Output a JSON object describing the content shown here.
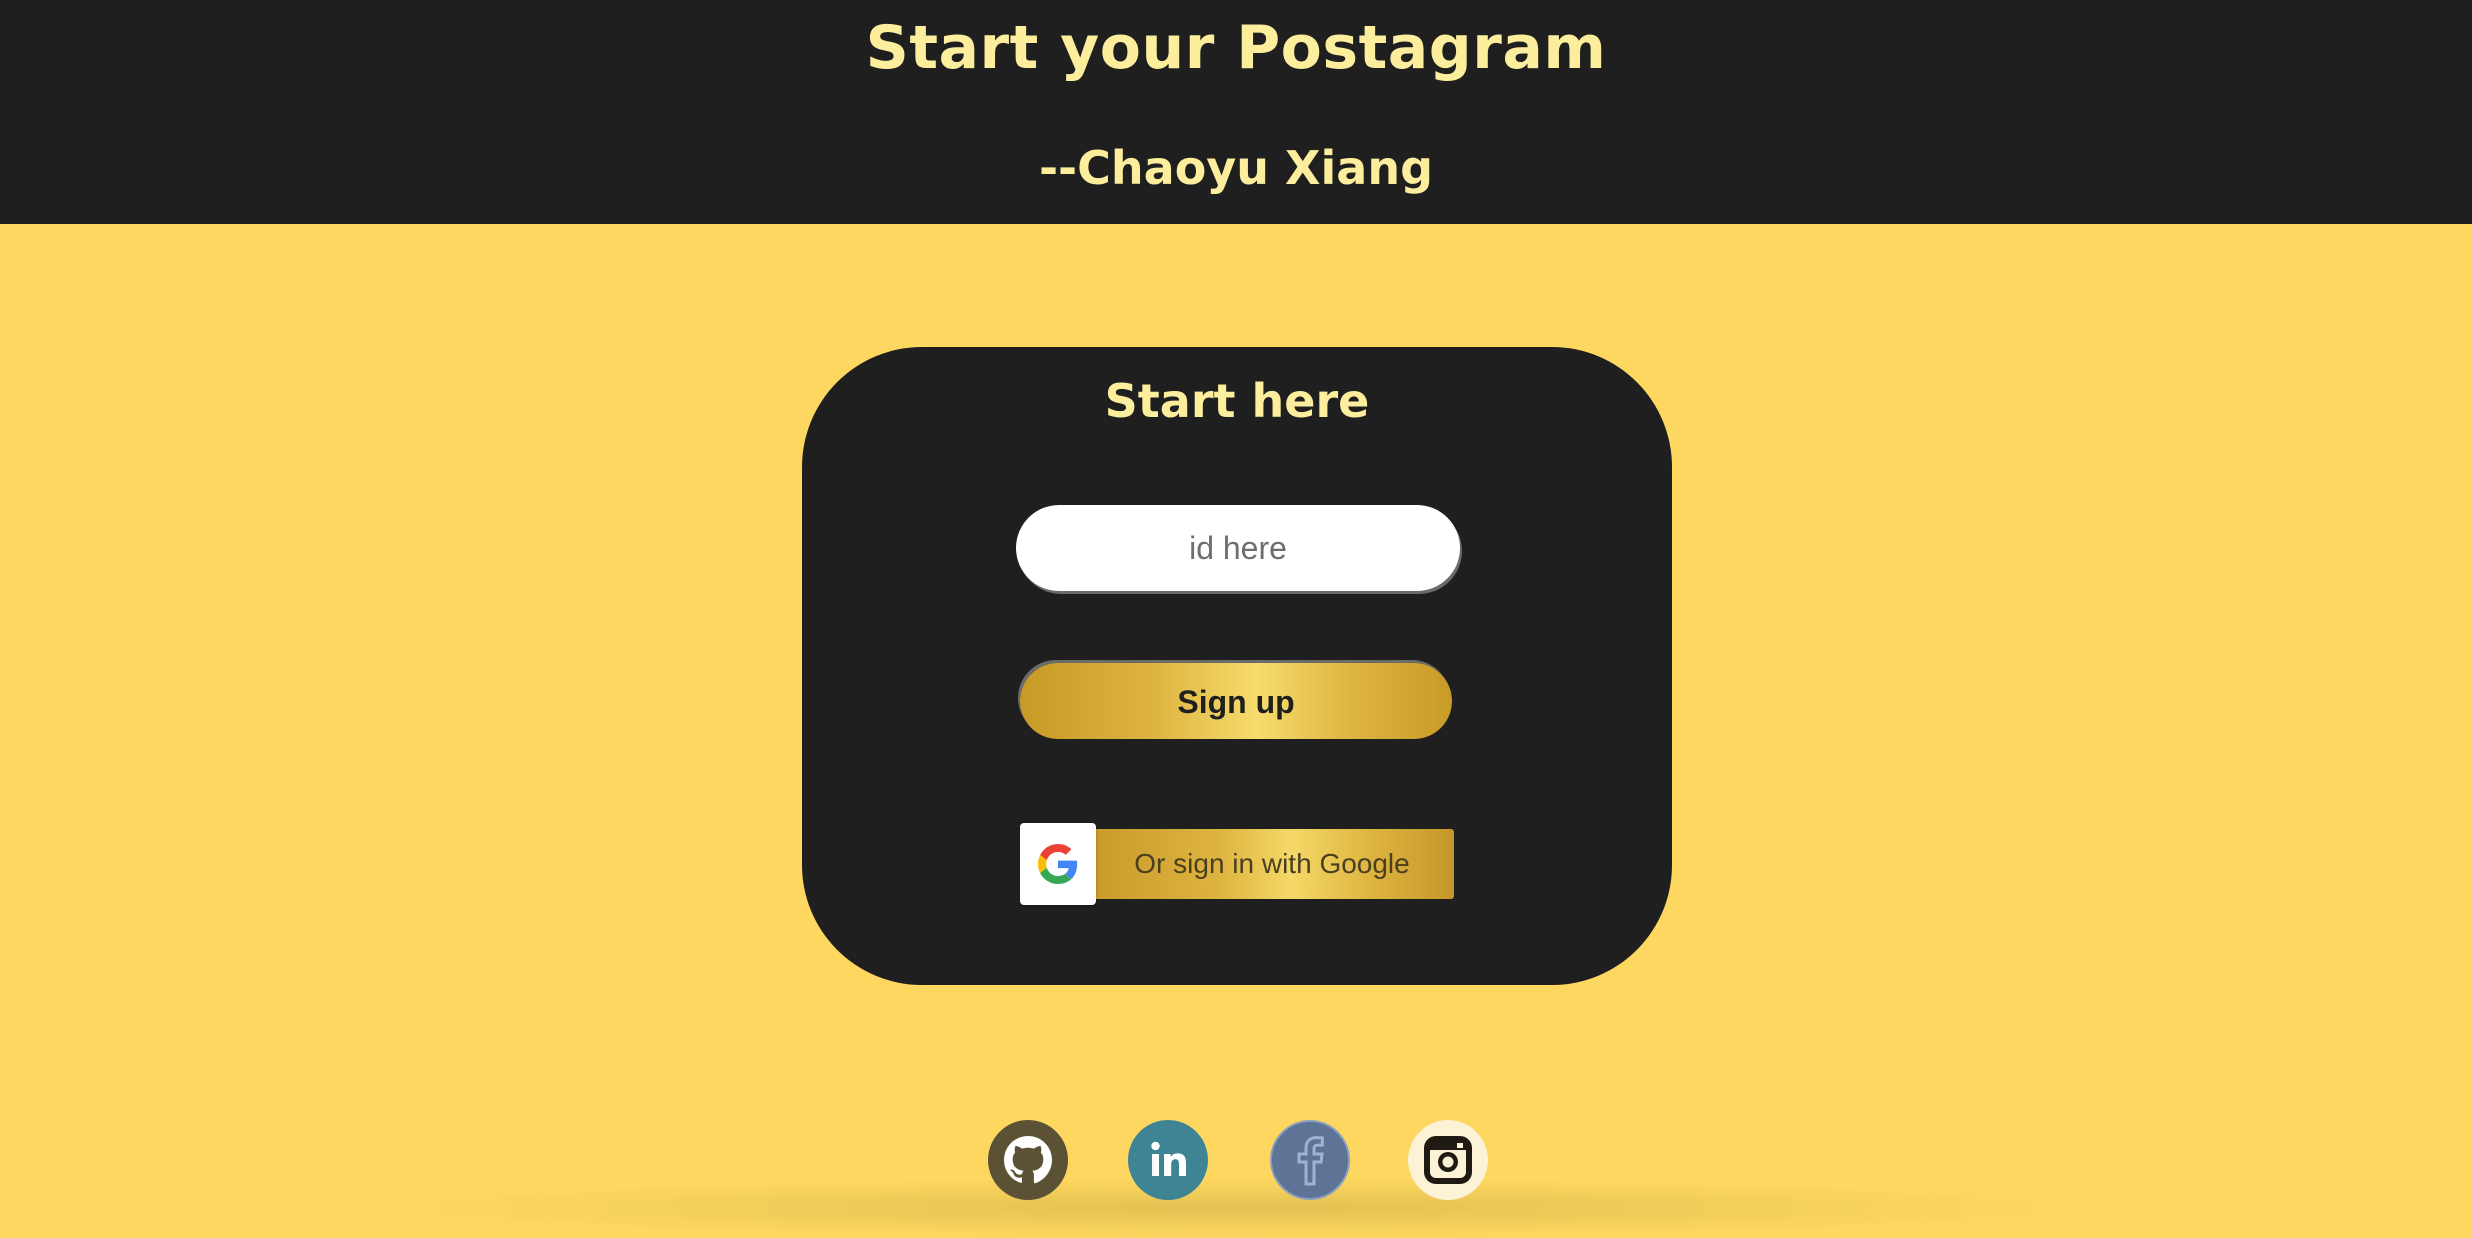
{
  "header": {
    "title": "Start your Postagram",
    "author": "--Chaoyu Xiang"
  },
  "card": {
    "title": "Start here",
    "id_input": {
      "placeholder": "id here",
      "value": ""
    },
    "signup_label": "Sign up",
    "google_label": "Or sign in with Google"
  },
  "social_links": [
    {
      "name": "github-icon",
      "color": "#5b5236"
    },
    {
      "name": "linkedin-icon",
      "color": "#3e8494"
    },
    {
      "name": "facebook-icon",
      "color": "#5e7497"
    },
    {
      "name": "instagram-icon",
      "color": "#fcf3d6"
    }
  ],
  "colors": {
    "background": "#fdd75f",
    "header_bg": "#1f1f1f",
    "accent_text": "#fcee9c",
    "gold": "#ddb23e"
  }
}
